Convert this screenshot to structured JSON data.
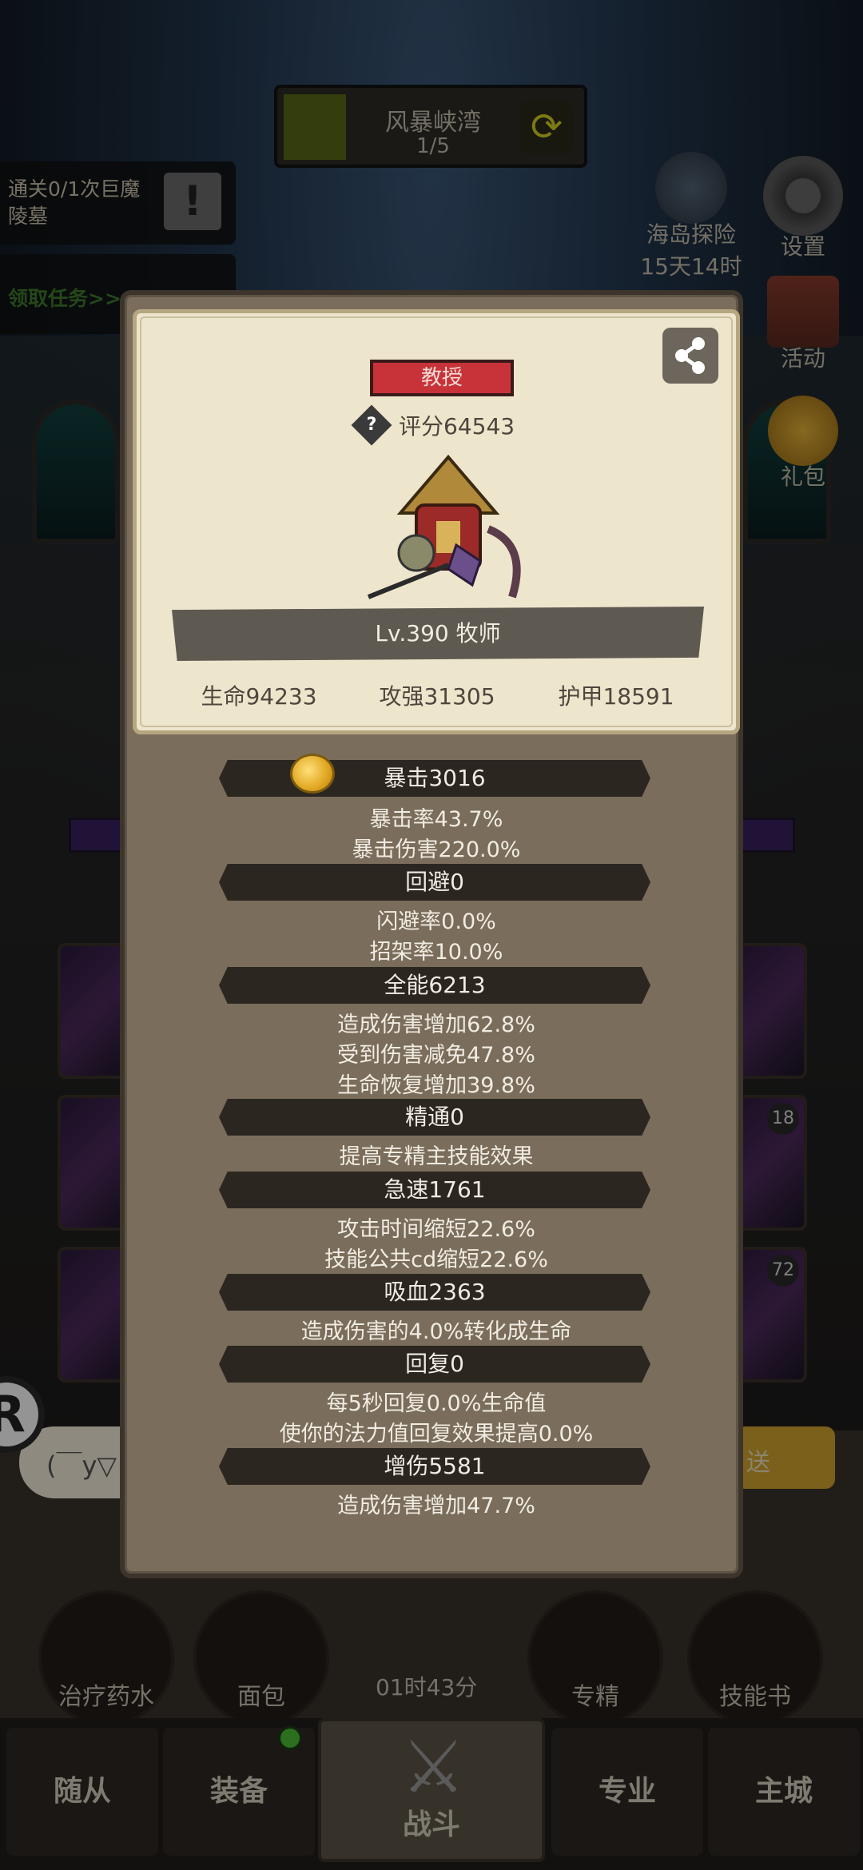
{
  "map": {
    "name": "风暴峡湾",
    "progress": "1/5"
  },
  "quest": {
    "text": "通关0/1次巨魔陵墓",
    "claim_label": "领取任务>>"
  },
  "right_menu": {
    "island": {
      "label": "海岛探险",
      "timer": "15天14时"
    },
    "settings": {
      "label": "设置"
    },
    "events": {
      "label": "活动"
    },
    "gift": {
      "label": "礼包"
    }
  },
  "profile": {
    "rank": "教授",
    "score": "评分64543",
    "level_class": "Lv.390 牧师",
    "health": "生命94233",
    "attack": "攻强31305",
    "armor": "护甲18591"
  },
  "sections": [
    {
      "title": "暴击3016",
      "details": [
        "暴击率43.7%",
        "暴击伤害220.0%"
      ]
    },
    {
      "title": "回避0",
      "details": [
        "闪避率0.0%",
        "招架率10.0%"
      ]
    },
    {
      "title": "全能6213",
      "details": [
        "造成伤害增加62.8%",
        "受到伤害减免47.8%",
        "生命恢复增加39.8%"
      ]
    },
    {
      "title": "精通0",
      "details": [
        "提高专精主技能效果"
      ]
    },
    {
      "title": "急速1761",
      "details": [
        "攻击时间缩短22.6%",
        "技能公共cd缩短22.6%"
      ]
    },
    {
      "title": "吸血2363",
      "details": [
        "造成伤害的4.0%转化成生命"
      ]
    },
    {
      "title": "回复0",
      "details": [
        "每5秒回复0.0%生命值",
        "使你的法力值回复效果提高0.0%"
      ]
    },
    {
      "title": "增伤5581",
      "details": [
        "造成伤害增加47.7%"
      ]
    }
  ],
  "chat": {
    "input_value": "(￣y▽",
    "send_label": "送"
  },
  "slot_badges": [
    "18",
    "72"
  ],
  "items": [
    {
      "label": "治疗药水"
    },
    {
      "label": "面包"
    },
    {
      "label": "专精"
    },
    {
      "label": "技能书"
    }
  ],
  "timer": "01时43分",
  "nav": [
    "随从",
    "装备",
    "战斗",
    "专业",
    "主城"
  ],
  "colors": {
    "rank_badge": "#c8333a",
    "modal_bg": "#7a6d5b",
    "card_bg": "#eee5cd",
    "section_bar": "#2c2621"
  }
}
